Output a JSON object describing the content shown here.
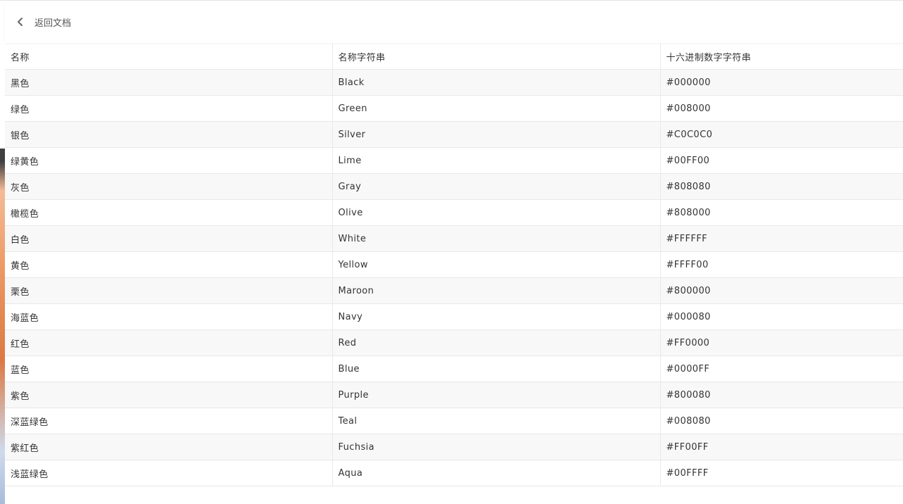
{
  "header": {
    "back_label": "返回文档",
    "back_icon": "chevron-left-icon"
  },
  "table": {
    "columns": [
      "名称",
      "名称字符串",
      "十六进制数字字符串"
    ],
    "rows": [
      [
        "黑色",
        "Black",
        "#000000"
      ],
      [
        "绿色",
        "Green",
        "#008000"
      ],
      [
        "银色",
        "Silver",
        "#C0C0C0"
      ],
      [
        "绿黄色",
        "Lime",
        "#00FF00"
      ],
      [
        "灰色",
        "Gray",
        "#808080"
      ],
      [
        "橄榄色",
        "Olive",
        "#808000"
      ],
      [
        "白色",
        "White",
        "#FFFFFF"
      ],
      [
        "黄色",
        "Yellow",
        "#FFFF00"
      ],
      [
        "栗色",
        "Maroon",
        "#800000"
      ],
      [
        "海蓝色",
        "Navy",
        "#000080"
      ],
      [
        "红色",
        "Red",
        "#FF0000"
      ],
      [
        "蓝色",
        "Blue",
        "#0000FF"
      ],
      [
        "紫色",
        "Purple",
        "#800080"
      ],
      [
        "深蓝绿色",
        "Teal",
        "#008080"
      ],
      [
        "紫红色",
        "Fuchsia",
        "#FF00FF"
      ],
      [
        "浅蓝绿色",
        "Aqua",
        "#00FFFF"
      ]
    ]
  }
}
